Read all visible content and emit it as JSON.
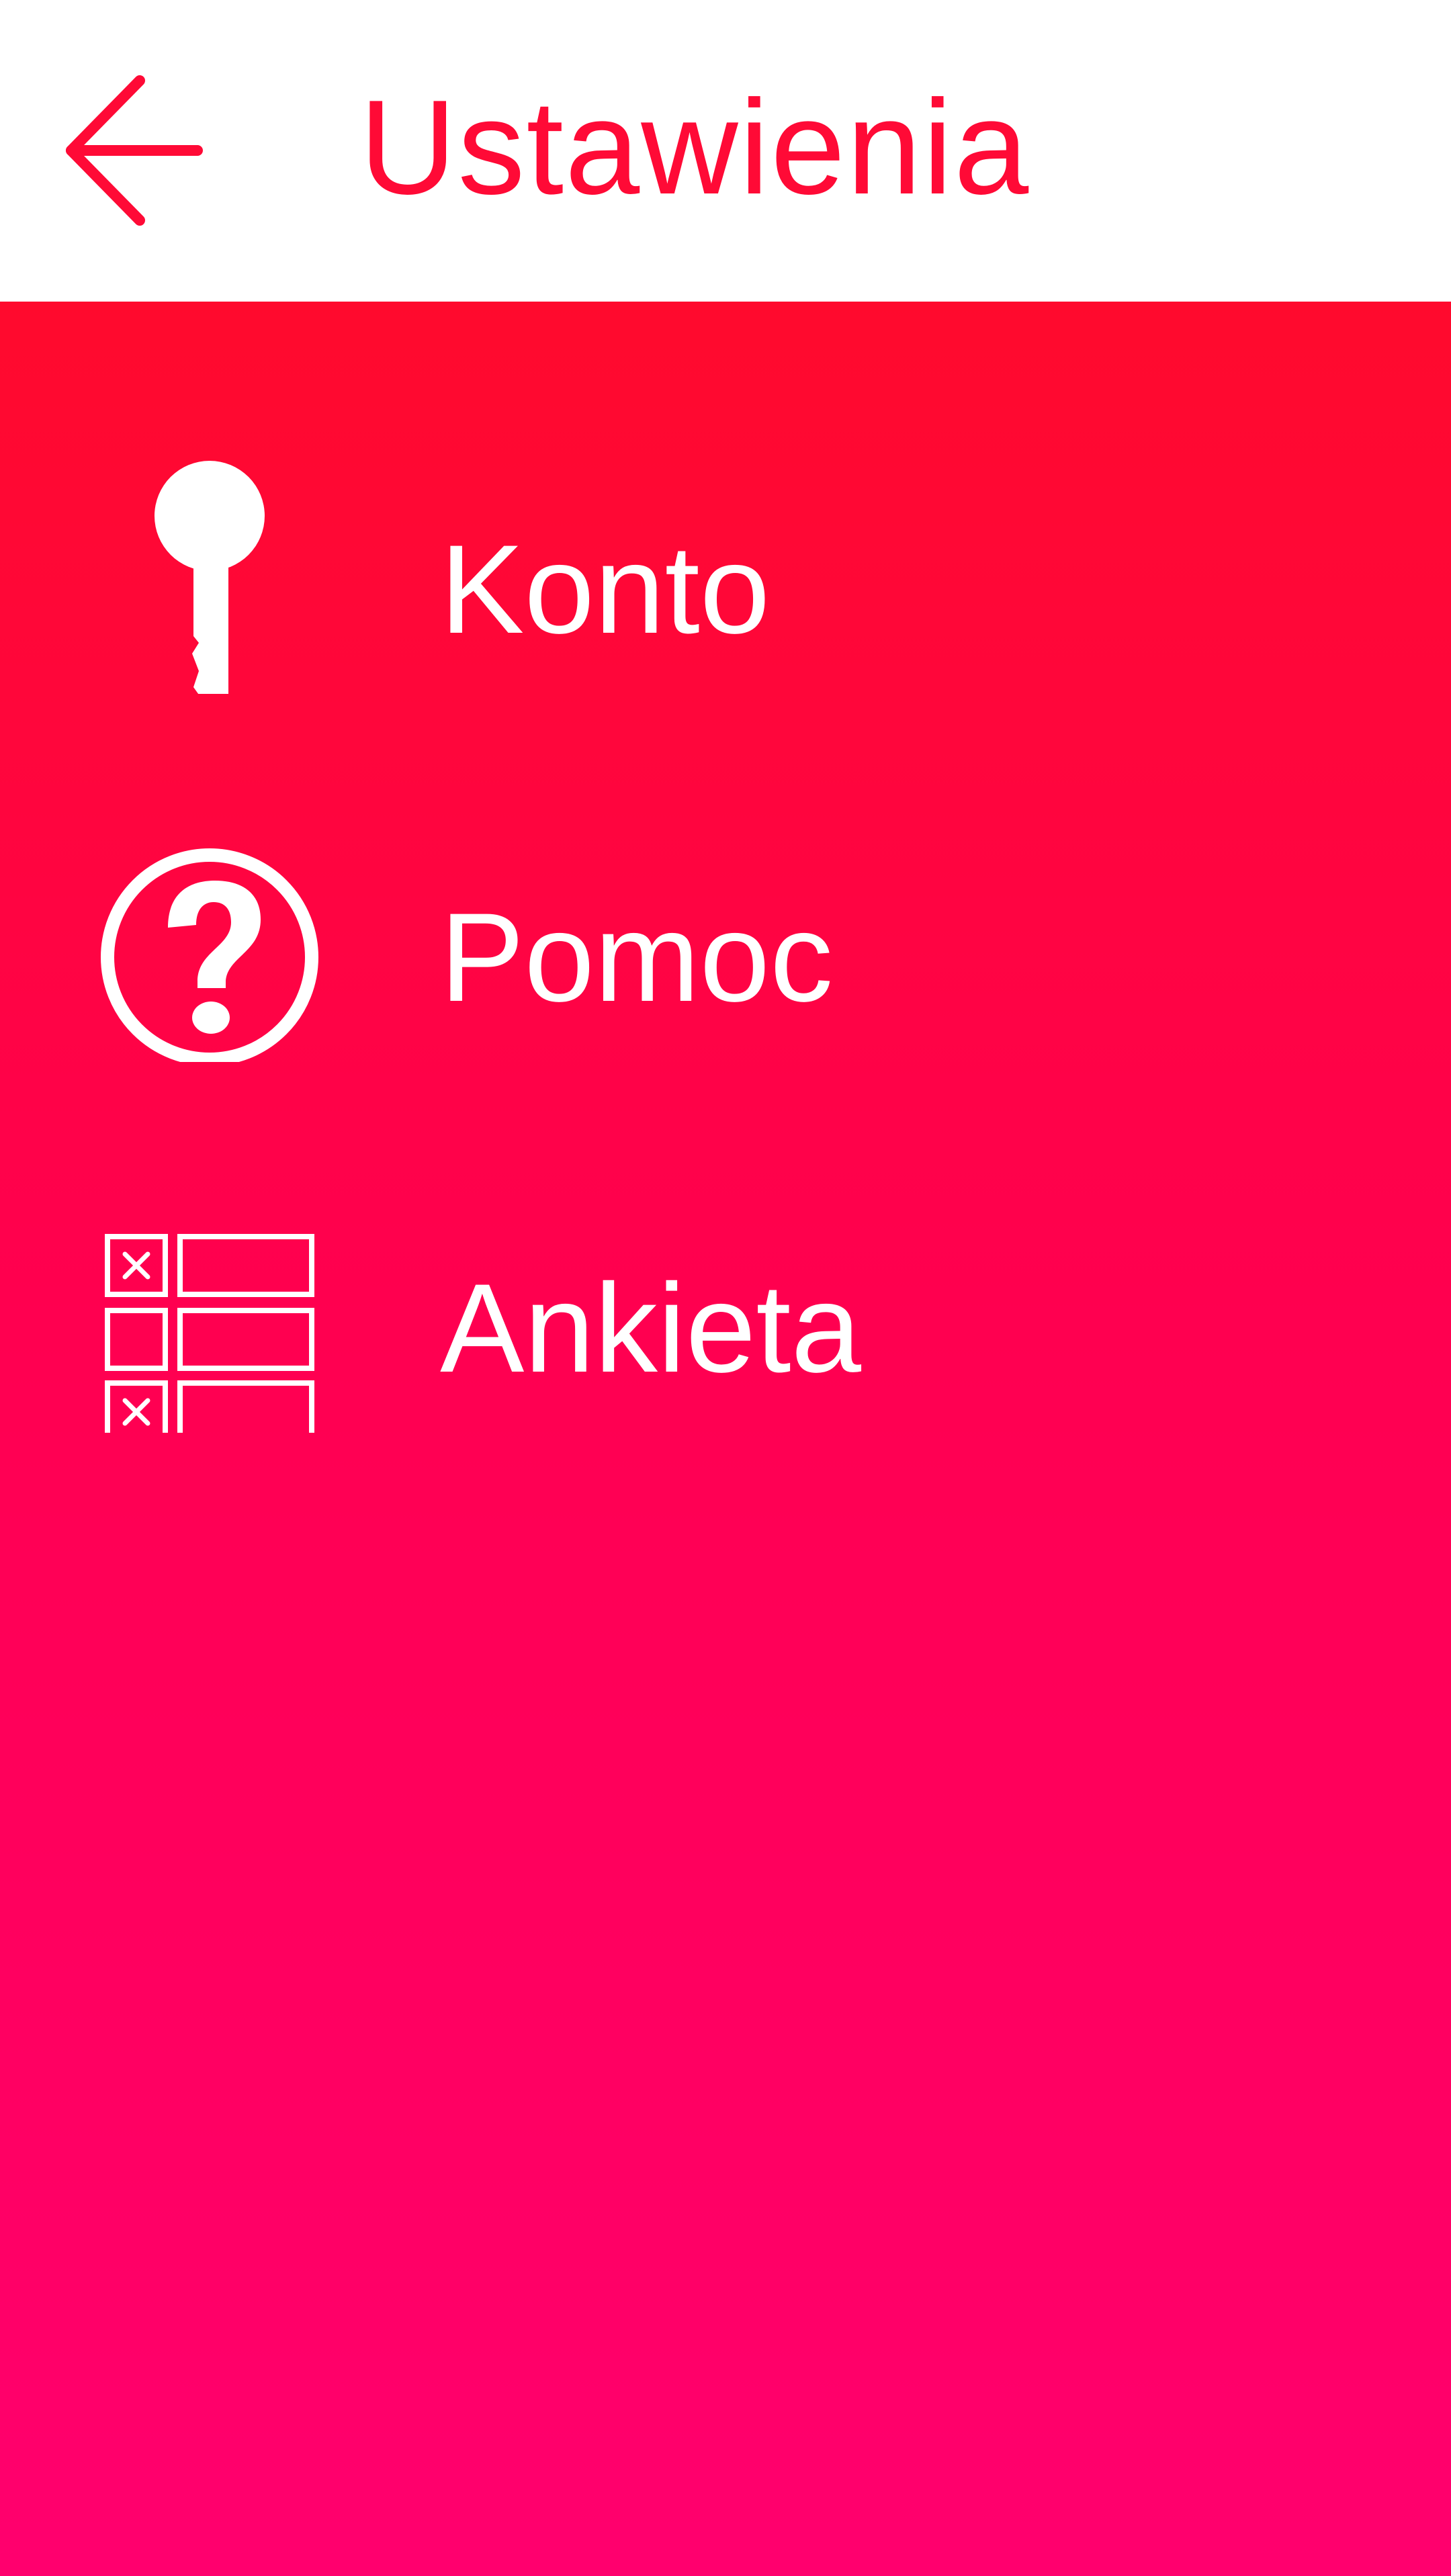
{
  "colors": {
    "accent": "#ff0a36",
    "header_background": "#ffffff",
    "gradient_top": "#ff0a2d",
    "gradient_bottom": "#ff006e",
    "text_on_accent": "#ffffff"
  },
  "header": {
    "back_icon": "arrow-left-icon",
    "title": "Ustawienia"
  },
  "menu": {
    "items": [
      {
        "icon": "key-icon",
        "label": "Konto"
      },
      {
        "icon": "help-circle-icon",
        "label": "Pomoc"
      },
      {
        "icon": "survey-checklist-icon",
        "label": "Ankieta"
      }
    ]
  }
}
